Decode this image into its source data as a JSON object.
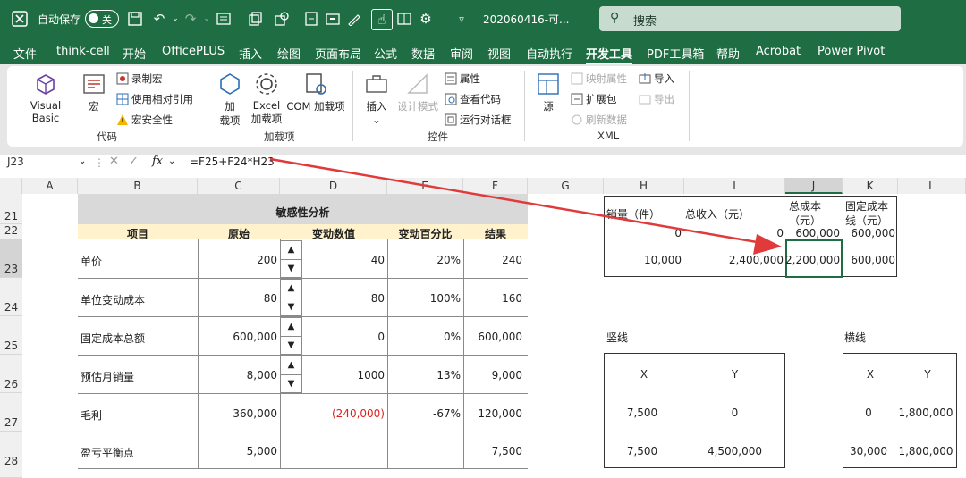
{
  "titlebar": {
    "autosave_label": "自动保存",
    "autosave_state": "关",
    "filename": "202060416-可...",
    "search_placeholder": "搜索"
  },
  "menu": [
    "文件",
    "think-cell",
    "开始",
    "OfficePLUS",
    "插入",
    "绘图",
    "页面布局",
    "公式",
    "数据",
    "审阅",
    "视图",
    "自动执行",
    "开发工具",
    "PDF工具箱",
    "帮助",
    "Acrobat",
    "Power Pivot"
  ],
  "menu_active": "开发工具",
  "ribbon": {
    "code": {
      "label": "代码",
      "visual_basic": "Visual Basic",
      "macro": "宏",
      "record_macro": "录制宏",
      "relative_ref": "使用相对引用",
      "macro_security": "宏安全性"
    },
    "addins": {
      "label": "加载项",
      "addin_line1": "加",
      "addin_line2": "载项",
      "excel_line1": "Excel",
      "excel_line2": "加载项",
      "com": "COM 加载项"
    },
    "controls": {
      "label": "控件",
      "insert": "插入",
      "design_mode": "设计模式",
      "properties": "属性",
      "view_code": "查看代码",
      "run_dialog": "运行对话框"
    },
    "xml": {
      "label": "XML",
      "source": "源",
      "map_props": "映射属性",
      "expansion": "扩展包",
      "refresh": "刷新数据",
      "import": "导入",
      "export": "导出"
    }
  },
  "formula_bar": {
    "name_box": "J23",
    "fx": "fx",
    "formula": "=F25+F24*H23"
  },
  "accent": "#1f6e43",
  "columns": [
    "A",
    "B",
    "C",
    "D",
    "E",
    "F",
    "G",
    "H",
    "I",
    "J",
    "K",
    "L"
  ],
  "rows": [
    "21",
    "22",
    "23",
    "24",
    "25",
    "26",
    "27",
    "28"
  ],
  "table": {
    "title": "敏感性分析",
    "headers": [
      "项目",
      "原始",
      "变动数值",
      "变动百分比",
      "结果"
    ],
    "data": [
      {
        "item": "单价",
        "orig": "200",
        "change": "40",
        "pct": "20%",
        "result": "240"
      },
      {
        "item": "单位变动成本",
        "orig": "80",
        "change": "80",
        "pct": "100%",
        "result": "160"
      },
      {
        "item": "固定成本总额",
        "orig": "600,000",
        "change": "0",
        "pct": "0%",
        "result": "600,000"
      },
      {
        "item": "预估月销量",
        "orig": "8,000",
        "change": "1000",
        "pct": "13%",
        "result": "9,000"
      },
      {
        "item": "毛利",
        "orig": "360,000",
        "change": "(240,000)",
        "pct": "-67%",
        "result": "120,000"
      },
      {
        "item": "盈亏平衡点",
        "orig": "5,000",
        "change": "",
        "pct": "",
        "result": "7,500"
      }
    ]
  },
  "right_table": {
    "h1": "销量（件）",
    "h2": "总收入（元）",
    "h3a": "总成本",
    "h3b": "（元）",
    "h4a": "固定成本",
    "h4b": "线（元）",
    "r1": [
      "0",
      "0",
      "600,000",
      "600,000"
    ],
    "r2": [
      "10,000",
      "2,400,000",
      "2,200,000",
      "600,000"
    ]
  },
  "vertical": {
    "label": "竖线",
    "x": "X",
    "y": "Y",
    "r1": [
      "7,500",
      "0"
    ],
    "r2": [
      "7,500",
      "4,500,000"
    ]
  },
  "horizontal": {
    "label": "横线",
    "x": "X",
    "y": "Y",
    "r1": [
      "0",
      "1,800,000"
    ],
    "r2": [
      "30,000",
      "1,800,000"
    ]
  }
}
